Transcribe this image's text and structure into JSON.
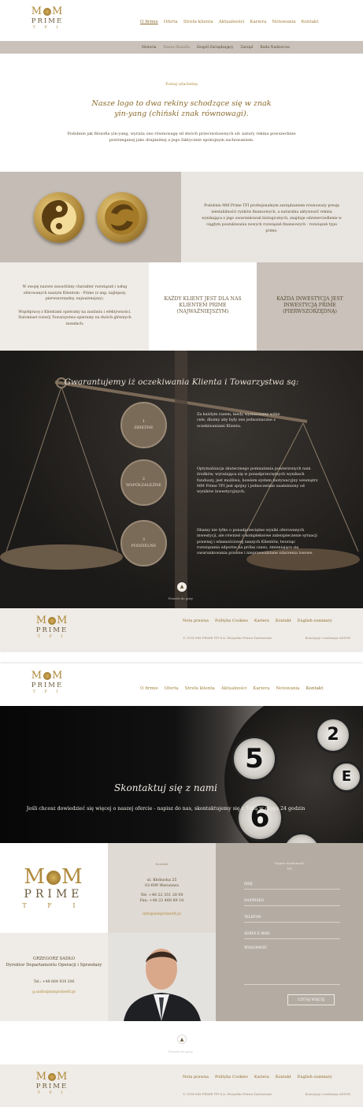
{
  "logo": {
    "mm": "M",
    "mm2": "M",
    "prime": "PRIME",
    "tfi": "T F I"
  },
  "nav": [
    "O firmie",
    "Oferta",
    "Strefa klienta",
    "Aktualności",
    "Kariera",
    "Notowania",
    "Kontakt"
  ],
  "subnav": [
    "Historia",
    "Nasza filozofia",
    "Zespół Zarządzający",
    "Zarząd",
    "Rada Nadzorcza"
  ],
  "intro": {
    "tag": "Poznaj szlachetną",
    "title": "Nasze logo to dwa rekiny schodzące się w znak yin-yang (chiński znak równowagi).",
    "body": "Podobnie jak filozofia yin-yang, wyraża ono równowagę sił dwóch przeciwstawnych sił: natury rekina powszechnie postrzeganej jako drapieżnej a jego faktycznie spokojnym zachowaniem."
  },
  "yinyang_text": "Podobnie MM Prime TFI profesjonalnym zarządzaniem równoważy presję niestabilności rynków finansowych, a naturalna aktywność rekina wynikająca z jego uwarunkowań biologicznych, znajduje odzwierciedlenie w ciągłym poszukiwaniu nowych rozwiązań finansowych - rozwiązań typu prime.",
  "row3": {
    "left_p1": "W swojej nazwie zawarliśmy charakter rozwiązań i usług oferowanych naszym Klientom - Prime (z ang. najlepszy, pierwszorzędny, najważniejszy).",
    "left_p2": "Współpracę z Klientami opieramy na zaufaniu i efektywności. Natomiast rozwój Towarzystwa opieramy na dwóch głównych zasadach:",
    "middle": "KAŻDY KLIENT JEST DLA NAS KLIENTEM PRIME (NAJWAŻNIEJSZYM)",
    "right": "KAŻDA INWESTYCJA JEST INWESTYCJĄ PRIME (PIERWSZORZĘDNĄ)"
  },
  "guarantee": {
    "title": "Gwarantujemy iż oczekiwania Klienta i Towarzystwa są:",
    "items": [
      {
        "num": "1",
        "label": "ZBIEŻNE",
        "text": "Za każdym razem, kiedy wyznaczamy sobie cele, dbamy aby były one jednoznaczne z oczekiwaniami Klienta."
      },
      {
        "num": "2",
        "label": "WSPÓŁZALEŻNE",
        "text": "Optymalizacja skutecznego pomnażania powierzonych nam środków, wyrażająca się w ponadprzeciętnych wynikach funduszy, jest możliwa, bowiem system motywacyjny wewnątrz MM Prime TFI jest spójny i jednocześnie uzależniony od wyników inwestycyjnych."
      },
      {
        "num": "3",
        "label": "PODZIELNE",
        "text": "Dbamy nie tylko o ponadprzeciętne wyniki oferowanych inwestycji, ale również o kompleksowe zabezpieczenie sytuacji prawnej i własnościowej naszych Klientów, tworząc rozwiązania odporne na próbę czasu, zmieniające się uwarunkowania prawne i nieprzewidziane zdarzenia losowe."
      }
    ],
    "up_label": "Powrót do góry"
  },
  "footer": {
    "links": [
      "Nota prawna",
      "Polityka Cookies",
      "Kariera",
      "Kontakt",
      "English summary"
    ],
    "copyright": "© 2014 MM PRIME TFI S.A. Wszystkie Prawa Zastrzeżone",
    "realization": "Koncepcja i realizacja ADVOX"
  },
  "contact_page": {
    "hero_title": "Skontaktuj się z nami",
    "hero_text": "Jeśli chcesz dowiedzieć się więcej o naszej ofercie - napisz do nas, skontaktujemy się z Tobą w ciągu 24 godzin",
    "address_label": "Kontakt",
    "address": [
      "ul. Kłobucka 25",
      "02-699 Warszawa",
      "",
      "Tel: +48 22 351 28 00",
      "Fax: +48 22 468 89 18"
    ],
    "email": "info@mmprimetfi.pl",
    "form_label": "Napisz wiadomość",
    "form_label2": "TFI",
    "fields": [
      "IMIĘ",
      "NAZWISKO",
      "TELEFON",
      "ADRES E-MAIL",
      "WIADOMOŚĆ"
    ],
    "submit": "CZYTAJ WIĘCEJ",
    "person_name": "GRZEGORZ SADŁO",
    "person_role": "Dyrektor Departamentu Operacji i Sprzedaży",
    "person_phone": "Tel.: +48 664 939 206",
    "person_email": "g.sadlo@mmprimetfi.pl",
    "up_label": "Powrót do góry"
  }
}
